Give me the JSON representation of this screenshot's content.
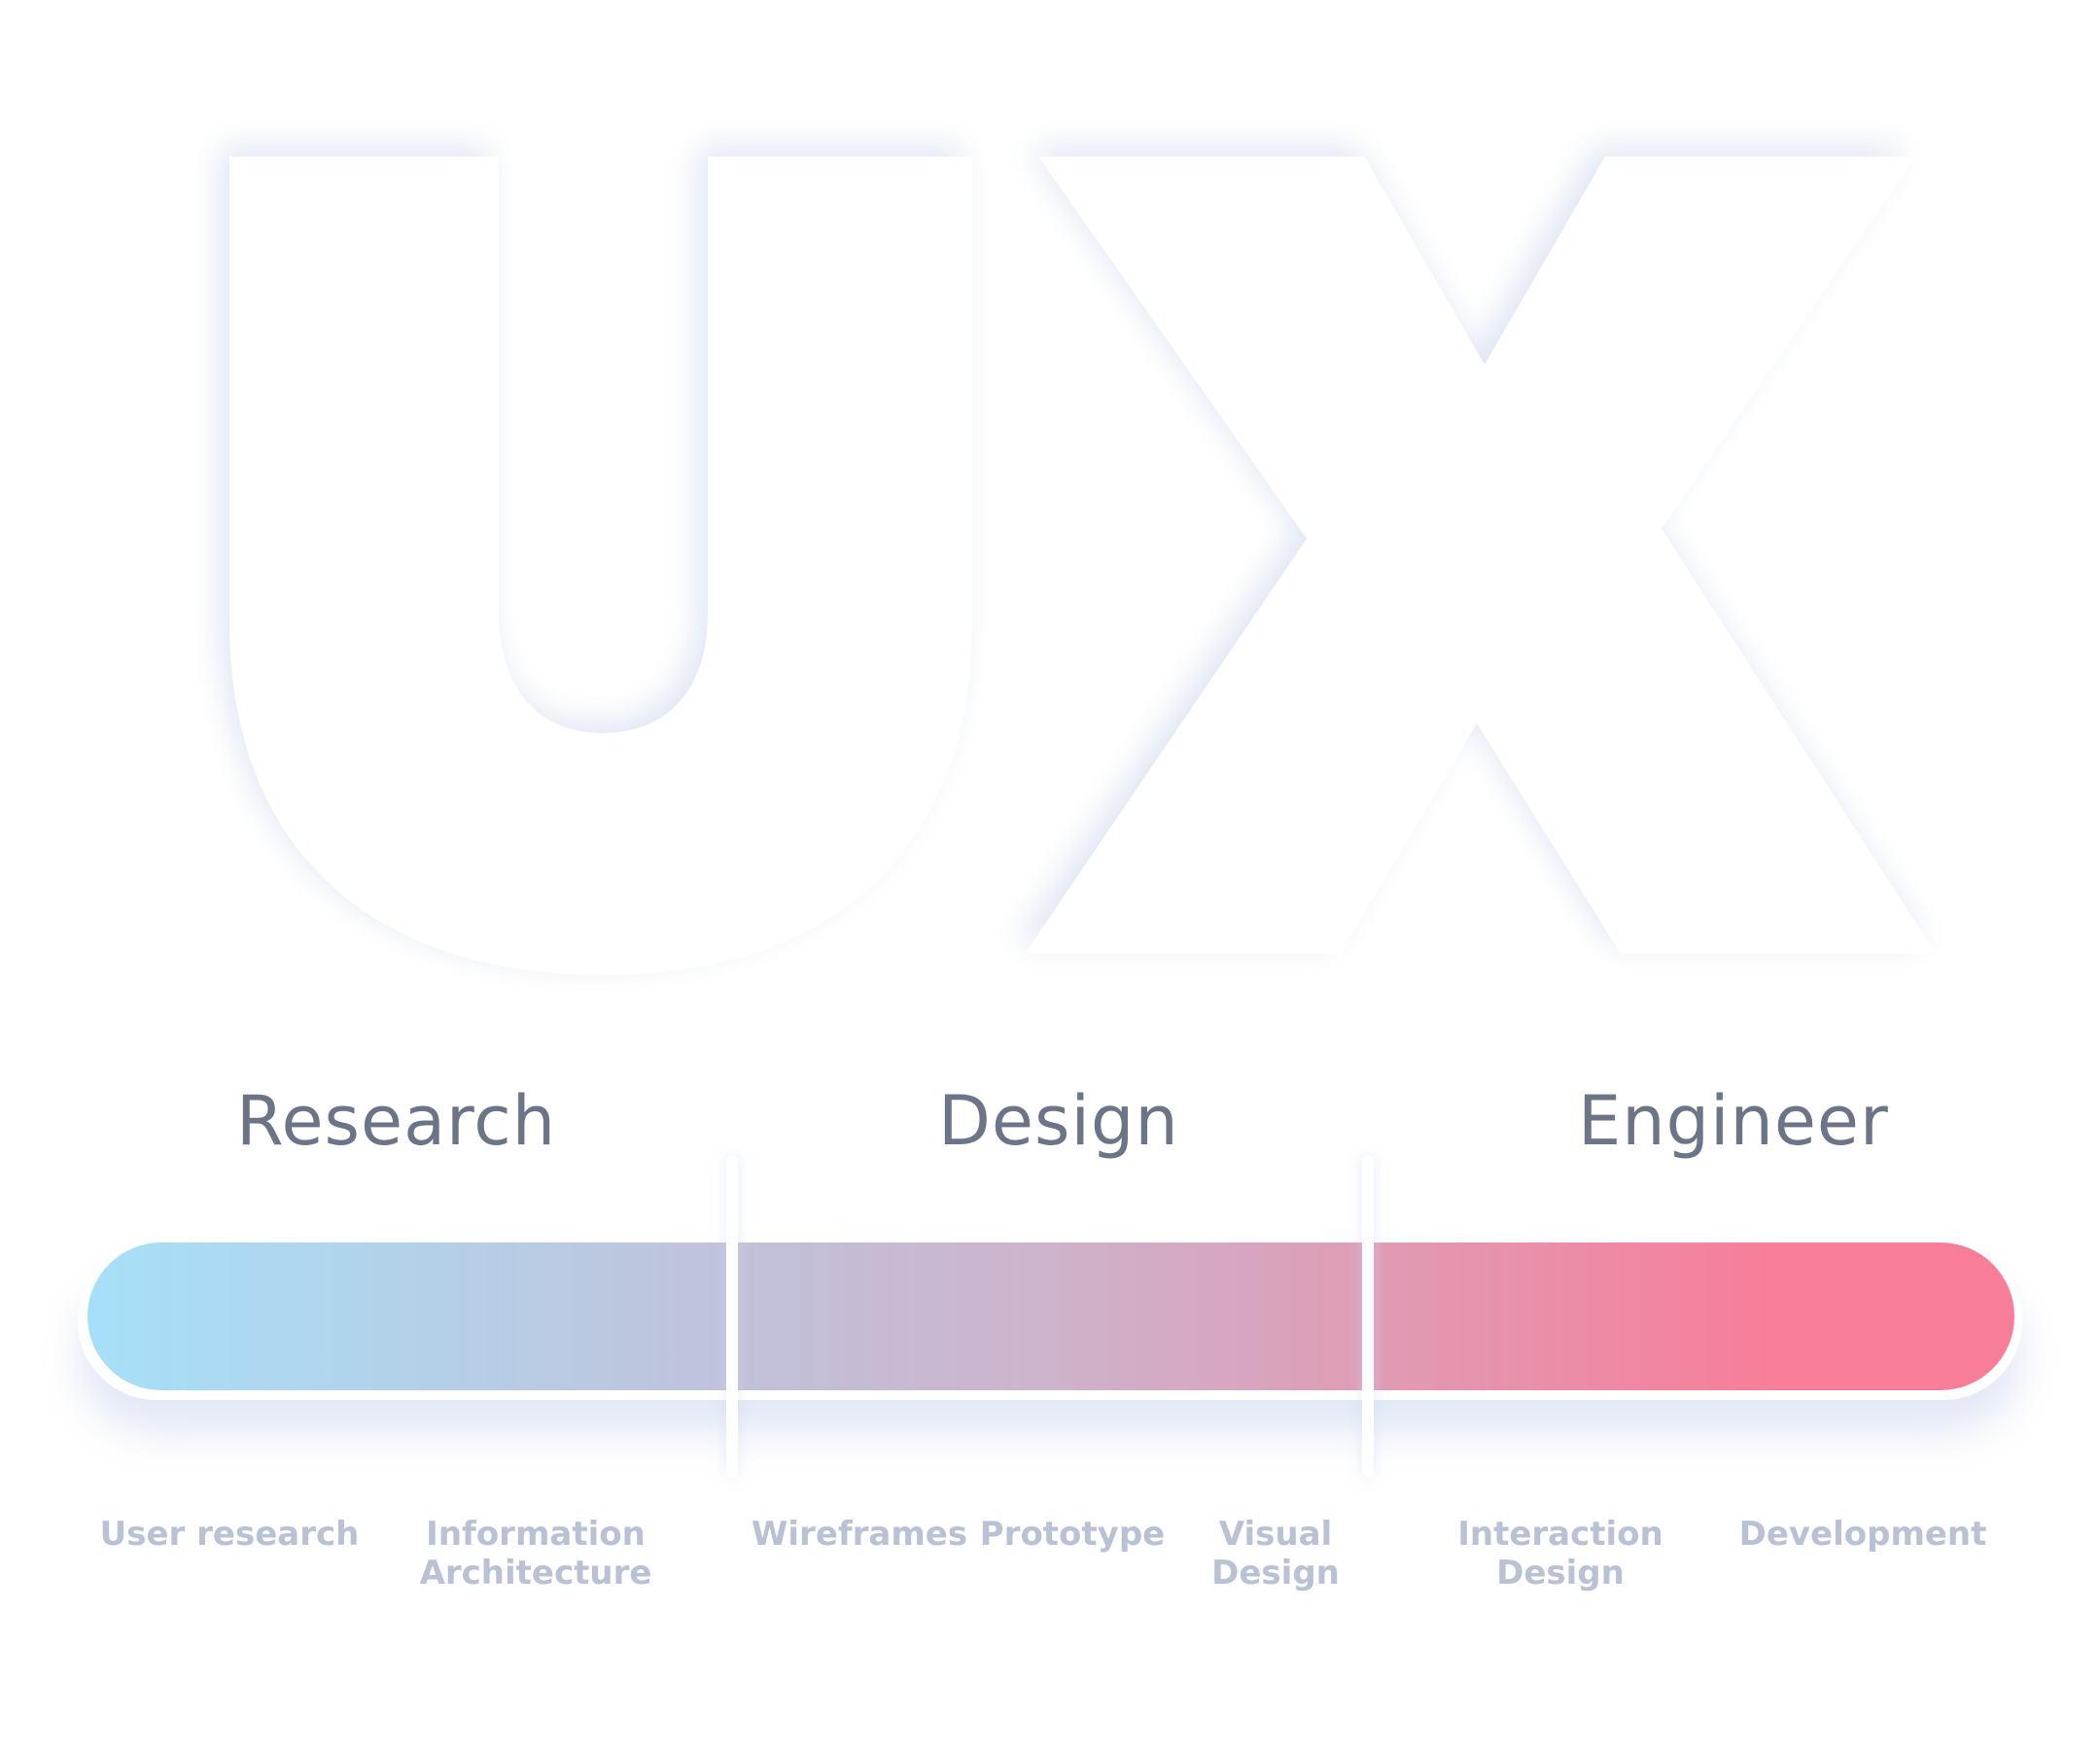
{
  "hero": {
    "letters": "UX",
    "letter_fill": "#FFFFFF",
    "shadow_color": "#DCE4F2"
  },
  "phases": [
    {
      "label": "Research"
    },
    {
      "label": "Design"
    },
    {
      "label": "Engineer"
    }
  ],
  "gradient": {
    "start_color": "#A6E0F8",
    "mid_color": "#CDB3CB",
    "end_color": "#F87D98"
  },
  "steps": [
    {
      "line1": "User research",
      "line2": ""
    },
    {
      "line1": "Information",
      "line2": "Architecture"
    },
    {
      "line1": "Wireframes",
      "line2": ""
    },
    {
      "line1": "Prototype",
      "line2": ""
    },
    {
      "line1": "Visual",
      "line2": "Design"
    },
    {
      "line1": "Interaction",
      "line2": "Design"
    },
    {
      "line1": "Development",
      "line2": ""
    }
  ],
  "colors": {
    "phase_title": "#6B7587",
    "step_label": "#B8C2D4"
  }
}
